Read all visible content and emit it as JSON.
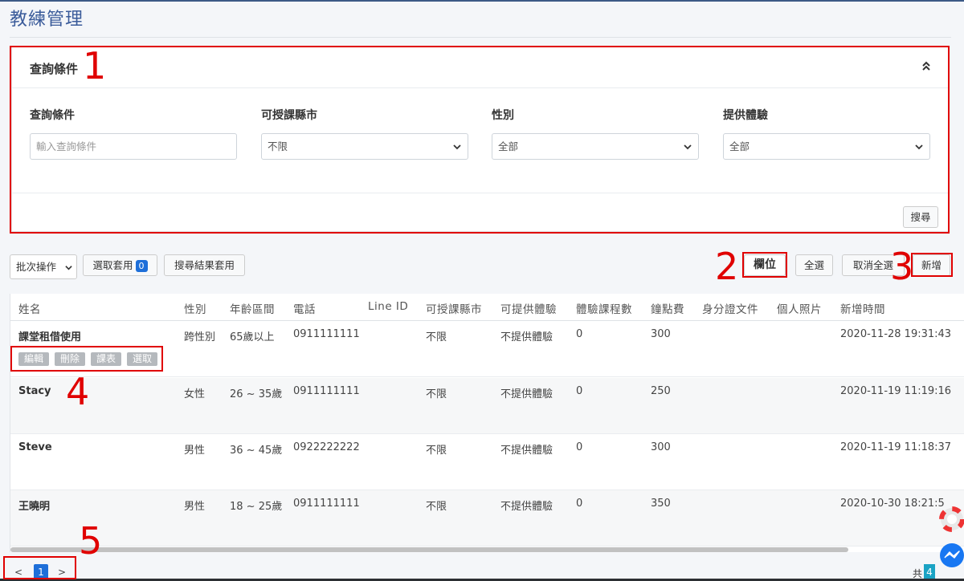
{
  "page": {
    "title": "教練管理"
  },
  "filter_panel": {
    "title": "查詢條件",
    "fields": [
      {
        "label": "查詢條件",
        "placeholder": "輸入查詢條件"
      },
      {
        "label": "可授課縣市",
        "value": "不限"
      },
      {
        "label": "性別",
        "value": "全部"
      },
      {
        "label": "提供體驗",
        "value": "全部"
      }
    ],
    "search_label": "搜尋"
  },
  "toolbar": {
    "batch_label": "批次操作",
    "apply_selected_label": "選取套用",
    "selected_count": "0",
    "apply_results_label": "搜尋結果套用",
    "columns_label": "欄位",
    "select_all_label": "全選",
    "deselect_all_label": "取消全選",
    "add_label": "新增"
  },
  "table": {
    "headers": [
      "姓名",
      "性別",
      "年齡區間",
      "電話",
      "Line ID",
      "可授課縣市",
      "可提供體驗",
      "體驗課程數",
      "鐘點費",
      "身分證文件",
      "個人照片",
      "新增時間"
    ],
    "rows": [
      {
        "name": "課堂租借使用",
        "gender": "跨性別",
        "age": "65歲以上",
        "phone": "0911111111",
        "line_id": "",
        "city": "不限",
        "experience": "不提供體驗",
        "course_count": "0",
        "fee": "300",
        "created": "2020-11-28 19:31:43"
      },
      {
        "name": "Stacy",
        "gender": "女性",
        "age": "26 ~ 35歲",
        "phone": "0911111111",
        "line_id": "",
        "city": "不限",
        "experience": "不提供體驗",
        "course_count": "0",
        "fee": "250",
        "created": "2020-11-19 11:19:16"
      },
      {
        "name": "Steve",
        "gender": "男性",
        "age": "36 ~ 45歲",
        "phone": "0922222222",
        "line_id": "",
        "city": "不限",
        "experience": "不提供體驗",
        "course_count": "0",
        "fee": "300",
        "created": "2020-11-19 11:18:37"
      },
      {
        "name": "王曉明",
        "gender": "男性",
        "age": "18 ~ 25歲",
        "phone": "0911111111",
        "line_id": "",
        "city": "不限",
        "experience": "不提供體驗",
        "course_count": "0",
        "fee": "350",
        "created": "2020-10-30 18:21:5"
      }
    ],
    "row_actions": [
      "編輯",
      "刪除",
      "課表",
      "選取"
    ]
  },
  "pagination": {
    "prev": "<",
    "current": "1",
    "next": ">",
    "total_prefix": "共",
    "total_count": "4"
  },
  "annotations": [
    "1",
    "2",
    "3",
    "4",
    "5"
  ],
  "colors": {
    "title": "#3a5b9a",
    "primary": "#1e6fd9",
    "annotation": "#e00000",
    "action_button": "#b5b9bd"
  },
  "icons": [
    "collapse-up-icon",
    "chevron-down-icon",
    "lifebuoy-icon",
    "messenger-icon"
  ]
}
